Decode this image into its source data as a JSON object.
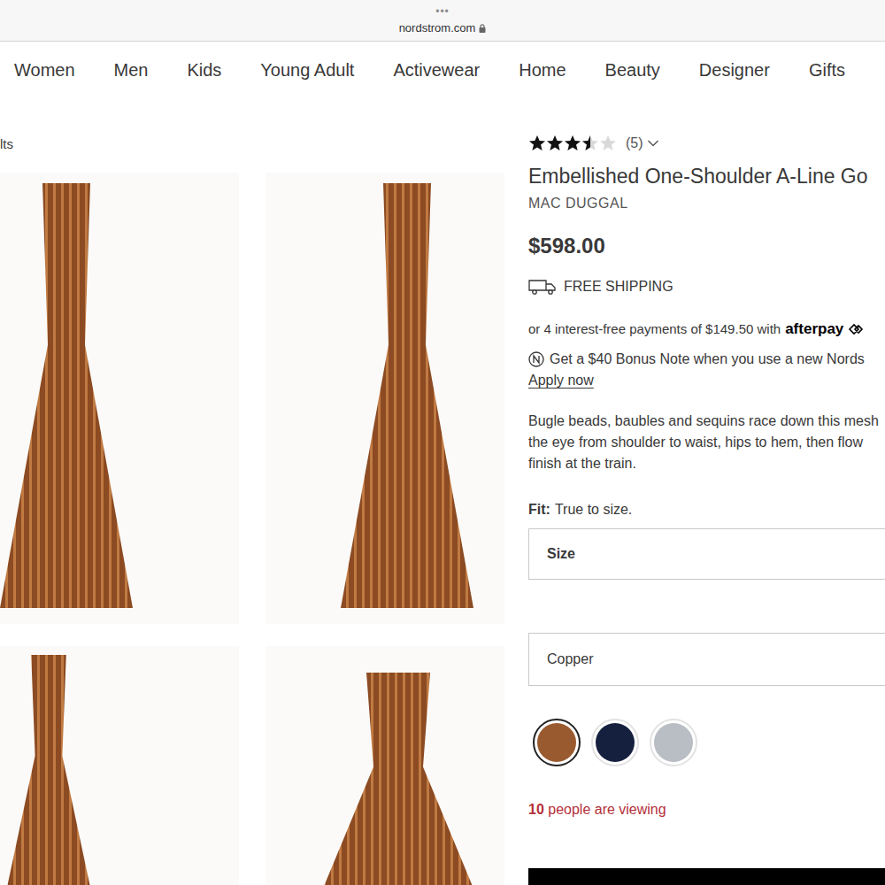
{
  "browser": {
    "menu": "•••",
    "url": "nordstrom.com"
  },
  "nav": [
    "Women",
    "Men",
    "Kids",
    "Young Adult",
    "Activewear",
    "Home",
    "Beauty",
    "Designer",
    "Gifts"
  ],
  "breadcrumb": "lts",
  "product": {
    "stars": 3.5,
    "review_count": "(5)",
    "title": "Embellished One-Shoulder A-Line Go",
    "brand": "MAC DUGGAL",
    "price": "$598.00",
    "shipping": "FREE SHIPPING",
    "afterpay_text": "or 4 interest-free payments of $149.50 with",
    "afterpay_logo": "afterpay",
    "bonus": "Get a $40 Bonus Note when you use a new Nords",
    "apply": "Apply now",
    "description": [
      "Bugle beads, baubles and sequins race down this mesh",
      "the eye from shoulder to waist, hips to hem, then flow",
      "finish at the train."
    ],
    "fit_label": "Fit:",
    "fit_value": "True to size.",
    "size_label": "Size",
    "color_value": "Copper",
    "swatches": [
      {
        "color": "#9a5a2f",
        "selected": true
      },
      {
        "color": "#15203f",
        "selected": false
      },
      {
        "color": "#b9bdc4",
        "selected": false
      }
    ],
    "viewers_count": "10",
    "viewers_text": " people are viewing"
  }
}
